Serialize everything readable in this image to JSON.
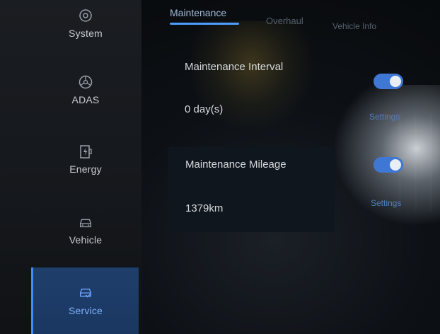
{
  "sidebar": {
    "items": [
      {
        "label": "System",
        "icon": "gear-icon"
      },
      {
        "label": "ADAS",
        "icon": "steering-wheel-icon"
      },
      {
        "label": "Energy",
        "icon": "battery-charge-icon"
      },
      {
        "label": "Vehicle",
        "icon": "car-icon"
      },
      {
        "label": "Service",
        "icon": "car-service-icon"
      }
    ],
    "active_index": 4
  },
  "tabs": [
    {
      "label": "Maintenance"
    },
    {
      "label": "Overhaul"
    },
    {
      "label": "Vehicle Info"
    }
  ],
  "maintenance_interval": {
    "label": "Maintenance Interval",
    "value": "0 day(s)",
    "settings": "Settings"
  },
  "maintenance_mileage": {
    "label": "Maintenance Mileage",
    "value": "1379km",
    "settings": "Settings"
  },
  "colors": {
    "accent": "#3f8cff",
    "toggle_on": "#3f78d4",
    "active_nav_bg": "#1f3f6b"
  }
}
